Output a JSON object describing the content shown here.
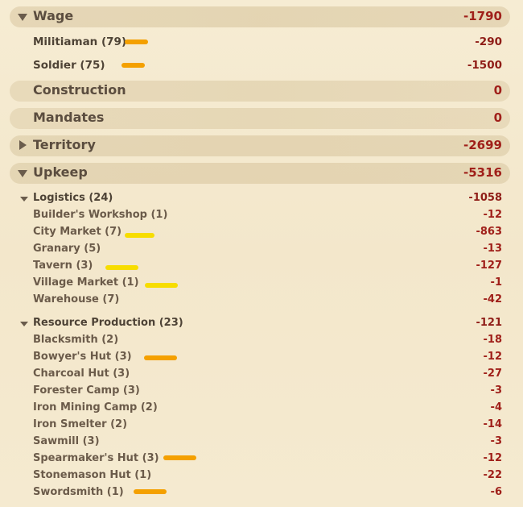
{
  "colors": {
    "orange_mark": "#f4a000",
    "yellow_mark": "#f7dd00",
    "negative_value": "#a0201a"
  },
  "wage": {
    "label": "Wage",
    "value": "-1790",
    "expanded": true,
    "items": [
      {
        "label": "Militiaman (79)",
        "value": "-290",
        "mark": "orange"
      },
      {
        "label": "Soldier (75)",
        "value": "-1500",
        "mark": "orange"
      }
    ]
  },
  "construction": {
    "label": "Construction",
    "value": "0"
  },
  "mandates": {
    "label": "Mandates",
    "value": "0"
  },
  "territory": {
    "label": "Territory",
    "value": "-2699",
    "expanded": false
  },
  "upkeep": {
    "label": "Upkeep",
    "value": "-5316",
    "expanded": true,
    "logistics": {
      "label": "Logistics (24)",
      "value": "-1058",
      "items": [
        {
          "label": "Builder's Workshop (1)",
          "value": "-12",
          "mark": ""
        },
        {
          "label": "City Market (7)",
          "value": "-863",
          "mark": "yellow"
        },
        {
          "label": "Granary (5)",
          "value": "-13",
          "mark": ""
        },
        {
          "label": "Tavern (3)",
          "value": "-127",
          "mark": "yellow"
        },
        {
          "label": "Village Market (1)",
          "value": "-1",
          "mark": "yellow"
        },
        {
          "label": "Warehouse (7)",
          "value": "-42",
          "mark": ""
        }
      ]
    },
    "resource_production": {
      "label": "Resource Production (23)",
      "value": "-121",
      "items": [
        {
          "label": "Blacksmith (2)",
          "value": "-18",
          "mark": ""
        },
        {
          "label": "Bowyer's Hut (3)",
          "value": "-12",
          "mark": "orange"
        },
        {
          "label": "Charcoal Hut (3)",
          "value": "-27",
          "mark": ""
        },
        {
          "label": "Forester Camp (3)",
          "value": "-3",
          "mark": ""
        },
        {
          "label": "Iron Mining Camp (2)",
          "value": "-4",
          "mark": ""
        },
        {
          "label": "Iron Smelter (2)",
          "value": "-14",
          "mark": ""
        },
        {
          "label": "Sawmill (3)",
          "value": "-3",
          "mark": ""
        },
        {
          "label": "Spearmaker's Hut (3)",
          "value": "-12",
          "mark": "orange"
        },
        {
          "label": "Stonemason Hut (1)",
          "value": "-22",
          "mark": ""
        },
        {
          "label": "Swordsmith (1)",
          "value": "-6",
          "mark": "orange"
        }
      ]
    }
  }
}
